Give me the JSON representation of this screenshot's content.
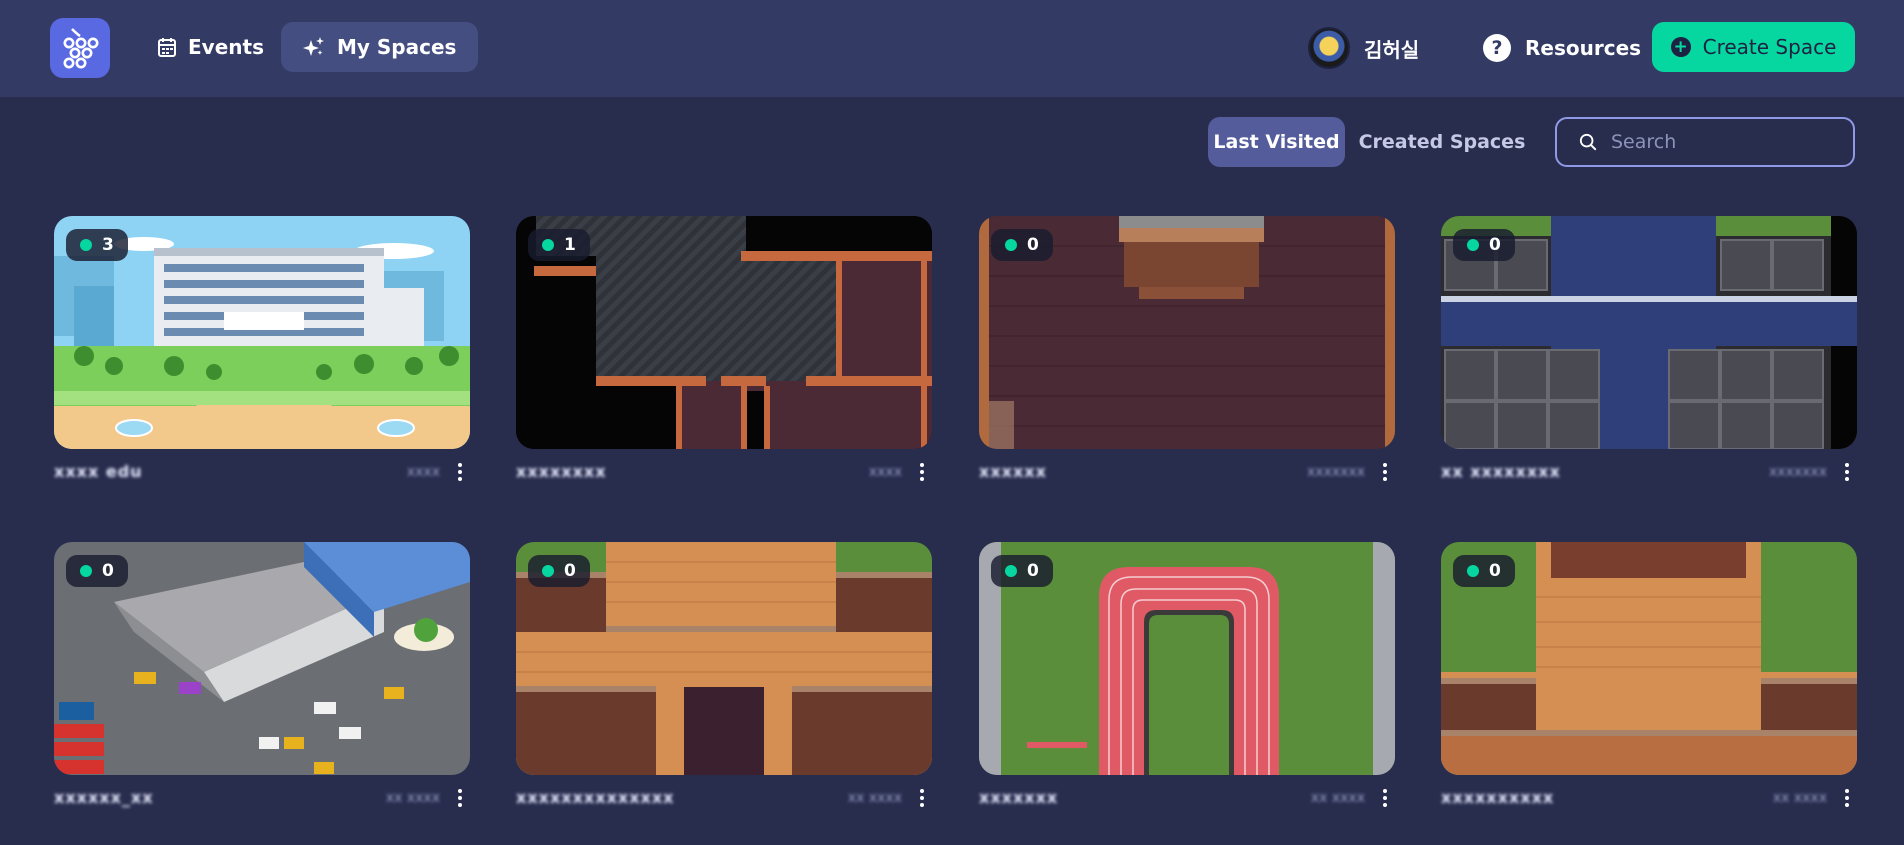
{
  "nav": {
    "events_label": "Events",
    "spaces_label": "My Spaces",
    "user_name": "김허실",
    "resources_label": "Resources",
    "create_label": "Create Space"
  },
  "filters": {
    "last_visited": "Last Visited",
    "created_spaces": "Created Spaces"
  },
  "search": {
    "placeholder": "Search"
  },
  "spaces": [
    {
      "online": "3",
      "title": "xxxx edu",
      "time": "xxxx"
    },
    {
      "online": "1",
      "title": "xxxxxxxx",
      "time": "xxxx"
    },
    {
      "online": "0",
      "title": "xxxxxx",
      "time": "xxxxxxx"
    },
    {
      "online": "0",
      "title": "xx xxxxxxxx",
      "time": "xxxxxxx"
    },
    {
      "online": "0",
      "title": "xxxxxx_xx",
      "time": "xx xxxx"
    },
    {
      "online": "0",
      "title": "xxxxxxxxxxxxxx",
      "time": "xx xxxx"
    },
    {
      "online": "0",
      "title": "xxxxxxx",
      "time": "xx xxxx"
    },
    {
      "online": "0",
      "title": "xxxxxxxxxx",
      "time": "xx xxxx"
    }
  ],
  "colors": {
    "background": "#282d4e",
    "topbar": "#333a64",
    "accent": "#06d6a0",
    "logo": "#5869e2",
    "active_tab": "#545c9c"
  }
}
